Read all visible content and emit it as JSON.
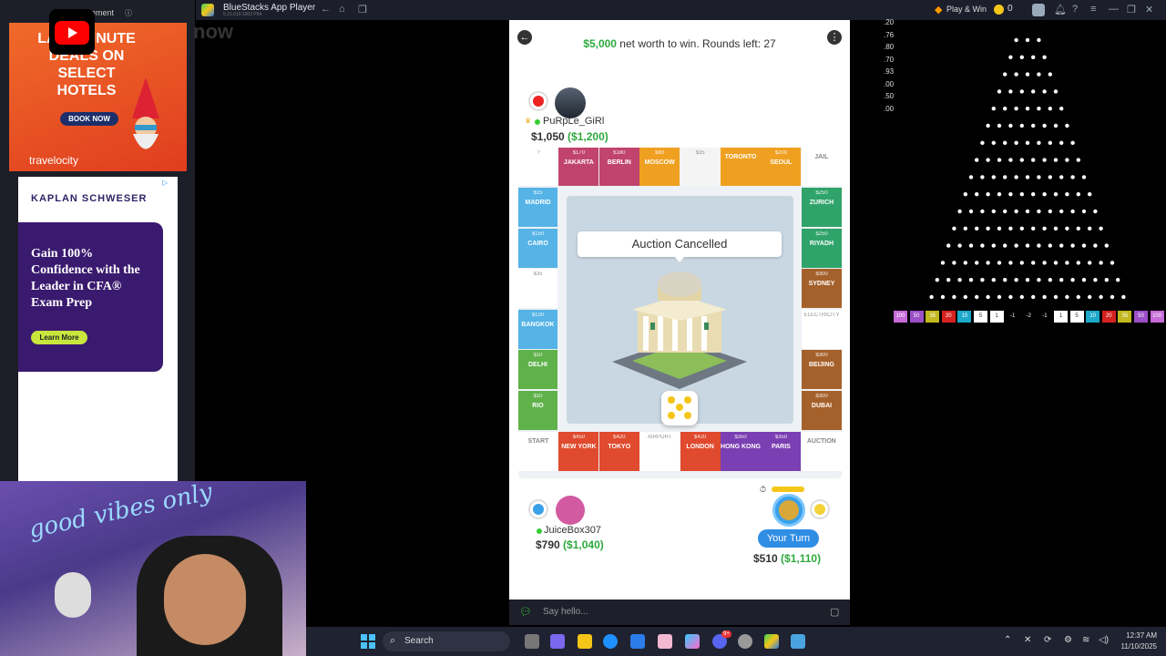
{
  "titlebar": {
    "app_name": "BlueStacks App Player",
    "version": "5.21.610.1003 P64",
    "play_win": "Play & Win",
    "coins": "0"
  },
  "ads": {
    "label": "ement",
    "youtube_text": "now",
    "travel": {
      "headline": "LAST-MINUTE DEALS ON SELECT HOTELS",
      "cta": "BOOK NOW",
      "brand": "travelocity"
    },
    "kaplan": {
      "brand": "KAPLAN SCHWESER",
      "headline": "Gain 100% Confidence with the Leader in CFA® Exam Prep",
      "cta": "Learn More"
    }
  },
  "game": {
    "goal_amount": "$5,000",
    "goal_text": " net worth to win. Rounds left: 27",
    "top_player": {
      "name": "PuRpLe_GiRl",
      "cash": "$1,050",
      "worth": "($1,200)"
    },
    "left_player": {
      "name": "JuiceBox307",
      "cash": "$790",
      "worth": "($1,040)"
    },
    "me": {
      "turn_label": "Your Turn",
      "cash": "$510",
      "worth": "($1,110)"
    },
    "banner": "Auction Cancelled",
    "chat_placeholder": "Say hello...",
    "top_row": [
      {
        "price": "?",
        "name": ""
      },
      {
        "price": "$170",
        "name": "JAKARTA"
      },
      {
        "price": "$180",
        "name": "BERLIN"
      },
      {
        "price": "$60",
        "name": "MOSCOW"
      },
      {
        "price": "$35",
        "name": ""
      },
      {
        "price": "",
        "name": "TORONTO"
      },
      {
        "price": "$200",
        "name": "SEOUL"
      },
      {
        "price": "",
        "name": "JAIL"
      }
    ],
    "left_col": [
      {
        "price": "$15",
        "name": "MADRID"
      },
      {
        "price": "$150",
        "name": "CAIRO"
      },
      {
        "price": "$35",
        "name": ""
      },
      {
        "price": "$130",
        "name": "BANGKOK"
      },
      {
        "price": "$10",
        "name": "DELHI"
      },
      {
        "price": "$10",
        "name": "RIO"
      }
    ],
    "right_col": [
      {
        "price": "$250",
        "name": "ZURICH"
      },
      {
        "price": "$250",
        "name": "RIYADH"
      },
      {
        "price": "$300",
        "name": "SYDNEY"
      },
      {
        "price": "ELECTRICITY",
        "name": ""
      },
      {
        "price": "$300",
        "name": "BEIJING"
      },
      {
        "price": "$300",
        "name": "DUBAI"
      }
    ],
    "bottom_row": [
      {
        "price": "",
        "name": "START"
      },
      {
        "price": "$450",
        "name": "NEW YORK"
      },
      {
        "price": "$420",
        "name": "TOKYO"
      },
      {
        "price": "AIRPORT",
        "name": ""
      },
      {
        "price": "$420",
        "name": "LONDON"
      },
      {
        "price": "$350",
        "name": "HONG KONG"
      },
      {
        "price": "$350",
        "name": "PARIS"
      },
      {
        "price": "",
        "name": "AUCTION"
      }
    ]
  },
  "plinko": {
    "odds": [
      ".20",
      ".76",
      ".80",
      ".70",
      ".93",
      ".00",
      ".50",
      ".00"
    ],
    "multipliers": [
      "100",
      "50",
      "35",
      "20",
      "10",
      "5",
      "1",
      "-1",
      "-2",
      "-1",
      "1",
      "5",
      "10",
      "20",
      "35",
      "50",
      "100"
    ]
  },
  "taskbar": {
    "search": "Search",
    "time": "12:37 AM",
    "date": "11/10/2025",
    "badge": "9+"
  }
}
